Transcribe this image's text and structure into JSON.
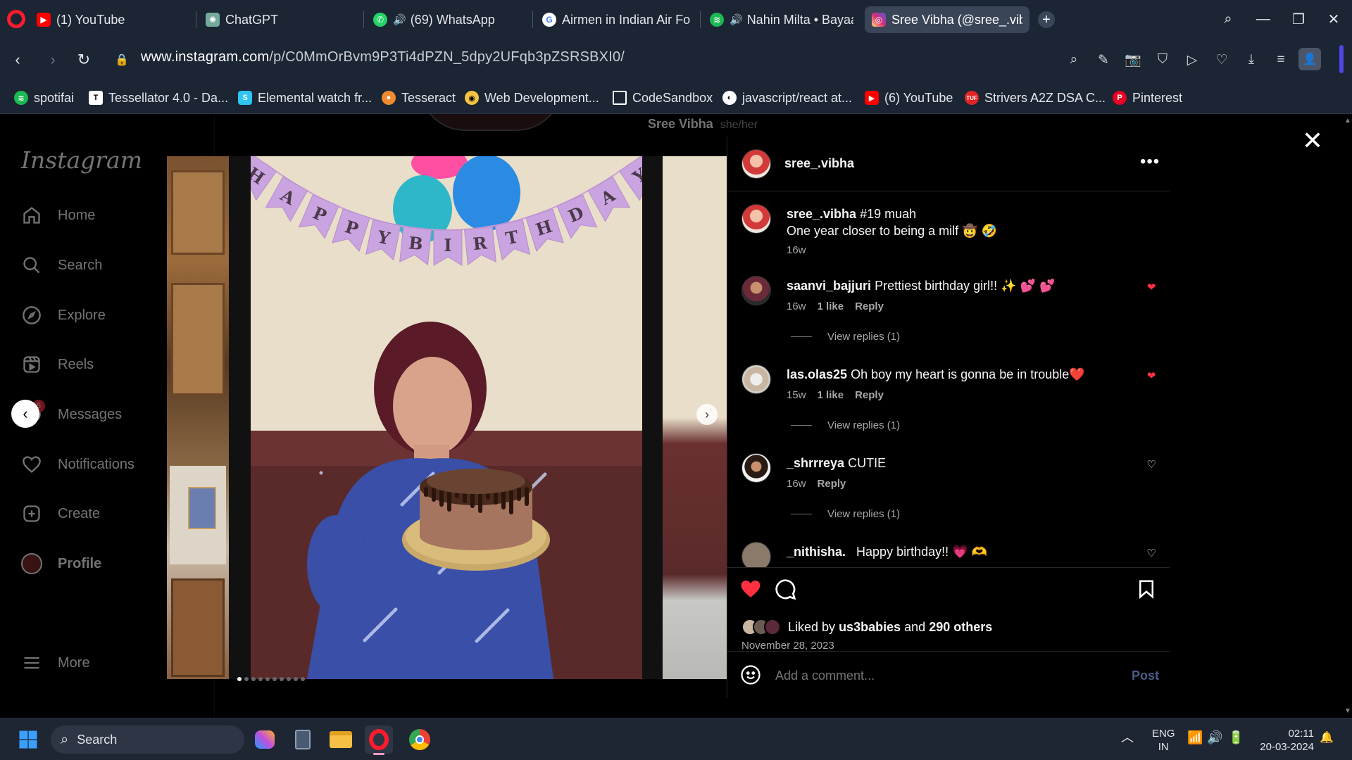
{
  "tabs": [
    {
      "title": "(1) YouTube",
      "icon": "youtube-icon",
      "color": "#ff0000",
      "sound": false
    },
    {
      "title": "ChatGPT",
      "icon": "chatgpt-icon",
      "color": "#74aa9c",
      "sound": false
    },
    {
      "title": "(69) WhatsApp",
      "icon": "whatsapp-icon",
      "color": "#25d366",
      "sound": true
    },
    {
      "title": "Airmen in Indian Air For",
      "icon": "google-icon",
      "color": "#4285f4",
      "sound": false
    },
    {
      "title": "Nahin Milta • Bayaan",
      "icon": "spotify-icon",
      "color": "#1db954",
      "sound": true
    },
    {
      "title": "Sree Vibha (@sree_.vibh",
      "icon": "instagram-icon",
      "color": "#e1306c",
      "sound": false,
      "active": true
    }
  ],
  "address": {
    "domain": "www.instagram.com",
    "path": "/p/C0MmOrBvm9P3Ti4dPZN_5dpy2UFqb3pZSRSBXI0/"
  },
  "bookmarks": [
    {
      "label": "spotifai",
      "icon": "spotify-icon",
      "color": "#1db954"
    },
    {
      "label": "Tessellator 4.0 - Da...",
      "icon": "tessellator-icon",
      "color": "#ffffff"
    },
    {
      "label": "Elemental watch fr...",
      "icon": "elemental-icon",
      "color": "#2ec4f1"
    },
    {
      "label": "Tesseract",
      "icon": "tesseract-icon",
      "color": "#f28b30"
    },
    {
      "label": "Web Development...",
      "icon": "web-dev-icon",
      "color": "#f5c542"
    },
    {
      "label": "CodeSandbox",
      "icon": "codesandbox-icon",
      "color": "#ffffff"
    },
    {
      "label": "javascript/react at...",
      "icon": "github-icon",
      "color": "#ffffff"
    },
    {
      "label": "(6) YouTube",
      "icon": "youtube-icon",
      "color": "#ff0000"
    },
    {
      "label": "Strivers A2Z DSA C...",
      "icon": "tuf-icon",
      "color": "#e02424"
    },
    {
      "label": "Pinterest",
      "icon": "pinterest-icon",
      "color": "#e60023"
    }
  ],
  "instagram": {
    "logo": "Instagram",
    "profile_header": {
      "name": "Sree Vibha",
      "pronouns": "she/her"
    },
    "nav": [
      {
        "label": "Home",
        "icon": "home-icon"
      },
      {
        "label": "Search",
        "icon": "search-icon"
      },
      {
        "label": "Explore",
        "icon": "compass-icon"
      },
      {
        "label": "Reels",
        "icon": "reels-icon"
      },
      {
        "label": "Messages",
        "icon": "messenger-icon",
        "badge": "5"
      },
      {
        "label": "Notifications",
        "icon": "heart-icon"
      },
      {
        "label": "Create",
        "icon": "plus-square-icon"
      },
      {
        "label": "Profile",
        "icon": "avatar"
      }
    ],
    "more_label": "More",
    "post": {
      "author": "sree_.vibha",
      "caption_tag": "#19 muah",
      "caption_line2": "One year closer to being a milf 🤠 🤣",
      "caption_age": "16w",
      "comments": [
        {
          "user": "saanvi_bajjuri",
          "text": "Prettiest birthday girl!! ✨ 💕 💕",
          "age": "16w",
          "likes": "1 like",
          "reply": "Reply",
          "replies": "View replies (1)",
          "liked": true
        },
        {
          "user": "las.olas25",
          "text": "Oh boy my heart is gonna be in trouble❤️",
          "age": "15w",
          "likes": "1 like",
          "reply": "Reply",
          "replies": "View replies (1)",
          "liked": true
        },
        {
          "user": "_shrrreya",
          "text": "CUTIE",
          "age": "16w",
          "likes": "",
          "reply": "Reply",
          "replies": "View replies (1)",
          "liked": false
        },
        {
          "user": "_nithisha.",
          "text": "Happy birthday!! 💗 🫶",
          "age": "",
          "likes": "",
          "reply": "",
          "replies": "",
          "liked": false
        }
      ],
      "liked_by_prefix": "Liked by",
      "liked_by_user": "us3babies",
      "liked_by_and": "and",
      "liked_by_others": "290 others",
      "date": "November 28, 2023",
      "comment_placeholder": "Add a comment...",
      "post_button": "Post",
      "carousel_count": 10,
      "carousel_index": 0,
      "banner_text": "HAPPY BIRTHDAY"
    }
  },
  "taskbar": {
    "search": "Search",
    "lang_line1": "ENG",
    "lang_line2": "IN",
    "time": "02:11",
    "date": "20-03-2024"
  }
}
